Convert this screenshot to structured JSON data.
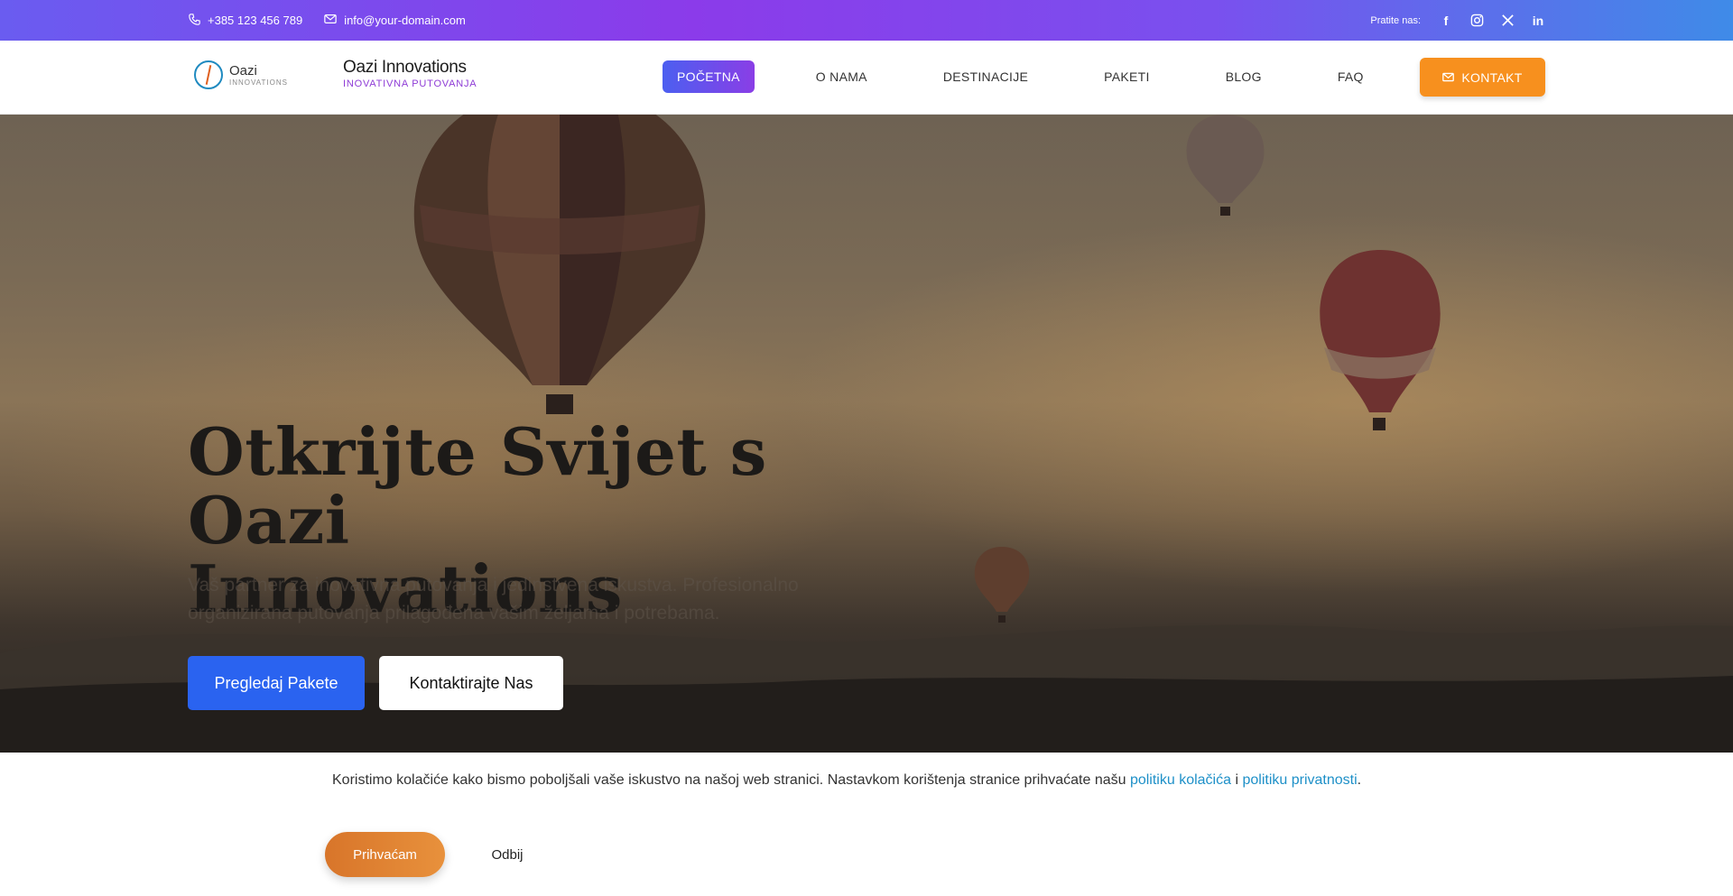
{
  "topbar": {
    "phone": "+385 123 456 789",
    "email": "info@your-domain.com",
    "follow_label": "Pratite nas:",
    "social": [
      "facebook-icon",
      "instagram-icon",
      "x-icon",
      "linkedin-icon"
    ]
  },
  "logo": {
    "name": "Oazi",
    "subtitle": "INNOVATIONS"
  },
  "brand": {
    "title": "Oazi Innovations",
    "tagline": "INOVATIVNA PUTOVANJA"
  },
  "nav": {
    "items": [
      {
        "label": "POČETNA",
        "active": true
      },
      {
        "label": "O NAMA"
      },
      {
        "label": "DESTINACIJE"
      },
      {
        "label": "PAKETI"
      },
      {
        "label": "BLOG"
      },
      {
        "label": "FAQ"
      }
    ],
    "cta": "KONTAKT"
  },
  "hero": {
    "title_line1": "Otkrijte Svijet s Oazi",
    "title_line2": "Innovations",
    "subtitle": "Vaš partner za inovativna putovanja i jedinstvena iskustva. Profesionalno organizirana putovanja prilagođena vašim željama i potrebama.",
    "btn_primary": "Pregledaj Pakete",
    "btn_secondary": "Kontaktirajte Nas"
  },
  "cookie": {
    "text": "Koristimo kolačiće kako bismo poboljšali vaše iskustvo na našoj web stranici. Nastavkom korištenja stranice prihvaćate našu ",
    "link1": "politiku kolačića",
    "joiner": " i ",
    "link2": "politiku privatnosti",
    "end": ".",
    "accept": "Prihvaćam",
    "reject": "Odbij"
  },
  "colors": {
    "accent_blue": "#2a63f0",
    "accent_purple": "#8a3ee6",
    "accent_orange": "#f7901e",
    "link": "#1e90c8"
  }
}
